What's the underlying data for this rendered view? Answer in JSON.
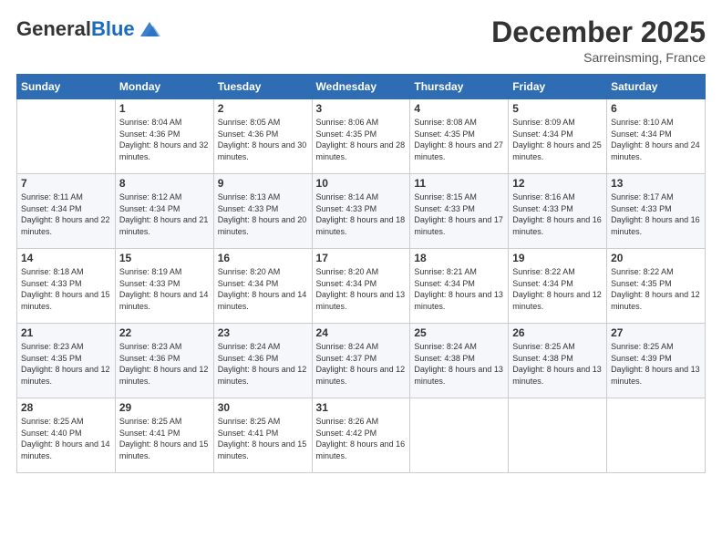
{
  "logo": {
    "general": "General",
    "blue": "Blue"
  },
  "header": {
    "month": "December 2025",
    "location": "Sarreinsming, France"
  },
  "weekdays": [
    "Sunday",
    "Monday",
    "Tuesday",
    "Wednesday",
    "Thursday",
    "Friday",
    "Saturday"
  ],
  "weeks": [
    [
      {
        "day": "",
        "sunrise": "",
        "sunset": "",
        "daylight": ""
      },
      {
        "day": "1",
        "sunrise": "Sunrise: 8:04 AM",
        "sunset": "Sunset: 4:36 PM",
        "daylight": "Daylight: 8 hours and 32 minutes."
      },
      {
        "day": "2",
        "sunrise": "Sunrise: 8:05 AM",
        "sunset": "Sunset: 4:36 PM",
        "daylight": "Daylight: 8 hours and 30 minutes."
      },
      {
        "day": "3",
        "sunrise": "Sunrise: 8:06 AM",
        "sunset": "Sunset: 4:35 PM",
        "daylight": "Daylight: 8 hours and 28 minutes."
      },
      {
        "day": "4",
        "sunrise": "Sunrise: 8:08 AM",
        "sunset": "Sunset: 4:35 PM",
        "daylight": "Daylight: 8 hours and 27 minutes."
      },
      {
        "day": "5",
        "sunrise": "Sunrise: 8:09 AM",
        "sunset": "Sunset: 4:34 PM",
        "daylight": "Daylight: 8 hours and 25 minutes."
      },
      {
        "day": "6",
        "sunrise": "Sunrise: 8:10 AM",
        "sunset": "Sunset: 4:34 PM",
        "daylight": "Daylight: 8 hours and 24 minutes."
      }
    ],
    [
      {
        "day": "7",
        "sunrise": "Sunrise: 8:11 AM",
        "sunset": "Sunset: 4:34 PM",
        "daylight": "Daylight: 8 hours and 22 minutes."
      },
      {
        "day": "8",
        "sunrise": "Sunrise: 8:12 AM",
        "sunset": "Sunset: 4:34 PM",
        "daylight": "Daylight: 8 hours and 21 minutes."
      },
      {
        "day": "9",
        "sunrise": "Sunrise: 8:13 AM",
        "sunset": "Sunset: 4:33 PM",
        "daylight": "Daylight: 8 hours and 20 minutes."
      },
      {
        "day": "10",
        "sunrise": "Sunrise: 8:14 AM",
        "sunset": "Sunset: 4:33 PM",
        "daylight": "Daylight: 8 hours and 18 minutes."
      },
      {
        "day": "11",
        "sunrise": "Sunrise: 8:15 AM",
        "sunset": "Sunset: 4:33 PM",
        "daylight": "Daylight: 8 hours and 17 minutes."
      },
      {
        "day": "12",
        "sunrise": "Sunrise: 8:16 AM",
        "sunset": "Sunset: 4:33 PM",
        "daylight": "Daylight: 8 hours and 16 minutes."
      },
      {
        "day": "13",
        "sunrise": "Sunrise: 8:17 AM",
        "sunset": "Sunset: 4:33 PM",
        "daylight": "Daylight: 8 hours and 16 minutes."
      }
    ],
    [
      {
        "day": "14",
        "sunrise": "Sunrise: 8:18 AM",
        "sunset": "Sunset: 4:33 PM",
        "daylight": "Daylight: 8 hours and 15 minutes."
      },
      {
        "day": "15",
        "sunrise": "Sunrise: 8:19 AM",
        "sunset": "Sunset: 4:33 PM",
        "daylight": "Daylight: 8 hours and 14 minutes."
      },
      {
        "day": "16",
        "sunrise": "Sunrise: 8:20 AM",
        "sunset": "Sunset: 4:34 PM",
        "daylight": "Daylight: 8 hours and 14 minutes."
      },
      {
        "day": "17",
        "sunrise": "Sunrise: 8:20 AM",
        "sunset": "Sunset: 4:34 PM",
        "daylight": "Daylight: 8 hours and 13 minutes."
      },
      {
        "day": "18",
        "sunrise": "Sunrise: 8:21 AM",
        "sunset": "Sunset: 4:34 PM",
        "daylight": "Daylight: 8 hours and 13 minutes."
      },
      {
        "day": "19",
        "sunrise": "Sunrise: 8:22 AM",
        "sunset": "Sunset: 4:34 PM",
        "daylight": "Daylight: 8 hours and 12 minutes."
      },
      {
        "day": "20",
        "sunrise": "Sunrise: 8:22 AM",
        "sunset": "Sunset: 4:35 PM",
        "daylight": "Daylight: 8 hours and 12 minutes."
      }
    ],
    [
      {
        "day": "21",
        "sunrise": "Sunrise: 8:23 AM",
        "sunset": "Sunset: 4:35 PM",
        "daylight": "Daylight: 8 hours and 12 minutes."
      },
      {
        "day": "22",
        "sunrise": "Sunrise: 8:23 AM",
        "sunset": "Sunset: 4:36 PM",
        "daylight": "Daylight: 8 hours and 12 minutes."
      },
      {
        "day": "23",
        "sunrise": "Sunrise: 8:24 AM",
        "sunset": "Sunset: 4:36 PM",
        "daylight": "Daylight: 8 hours and 12 minutes."
      },
      {
        "day": "24",
        "sunrise": "Sunrise: 8:24 AM",
        "sunset": "Sunset: 4:37 PM",
        "daylight": "Daylight: 8 hours and 12 minutes."
      },
      {
        "day": "25",
        "sunrise": "Sunrise: 8:24 AM",
        "sunset": "Sunset: 4:38 PM",
        "daylight": "Daylight: 8 hours and 13 minutes."
      },
      {
        "day": "26",
        "sunrise": "Sunrise: 8:25 AM",
        "sunset": "Sunset: 4:38 PM",
        "daylight": "Daylight: 8 hours and 13 minutes."
      },
      {
        "day": "27",
        "sunrise": "Sunrise: 8:25 AM",
        "sunset": "Sunset: 4:39 PM",
        "daylight": "Daylight: 8 hours and 13 minutes."
      }
    ],
    [
      {
        "day": "28",
        "sunrise": "Sunrise: 8:25 AM",
        "sunset": "Sunset: 4:40 PM",
        "daylight": "Daylight: 8 hours and 14 minutes."
      },
      {
        "day": "29",
        "sunrise": "Sunrise: 8:25 AM",
        "sunset": "Sunset: 4:41 PM",
        "daylight": "Daylight: 8 hours and 15 minutes."
      },
      {
        "day": "30",
        "sunrise": "Sunrise: 8:25 AM",
        "sunset": "Sunset: 4:41 PM",
        "daylight": "Daylight: 8 hours and 15 minutes."
      },
      {
        "day": "31",
        "sunrise": "Sunrise: 8:26 AM",
        "sunset": "Sunset: 4:42 PM",
        "daylight": "Daylight: 8 hours and 16 minutes."
      },
      {
        "day": "",
        "sunrise": "",
        "sunset": "",
        "daylight": ""
      },
      {
        "day": "",
        "sunrise": "",
        "sunset": "",
        "daylight": ""
      },
      {
        "day": "",
        "sunrise": "",
        "sunset": "",
        "daylight": ""
      }
    ]
  ]
}
